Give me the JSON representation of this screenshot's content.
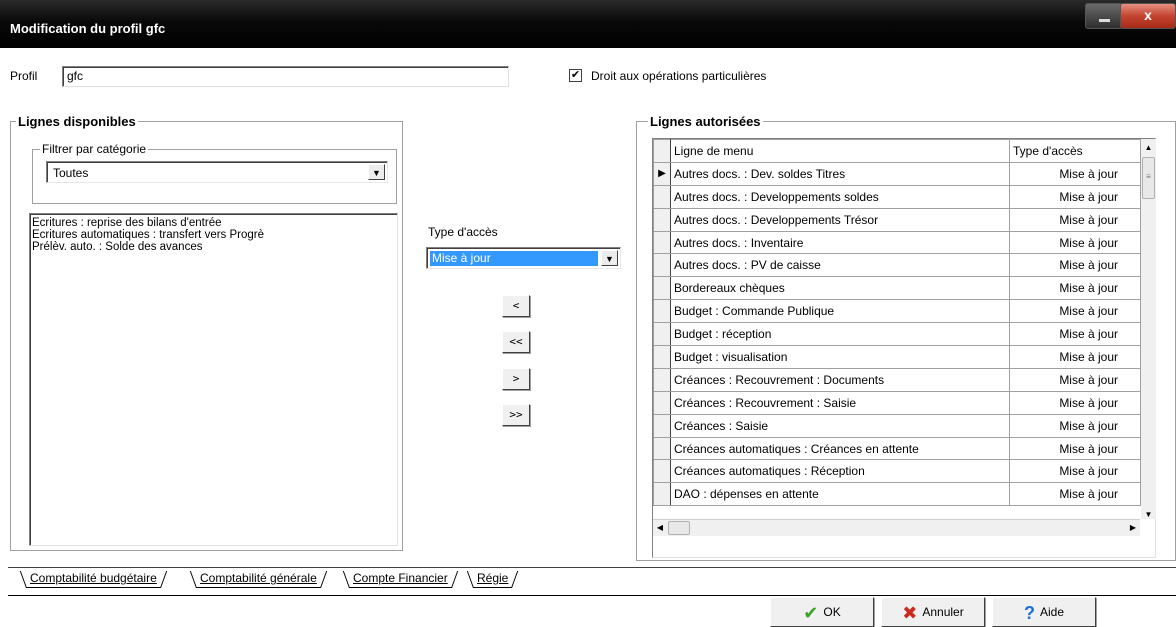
{
  "window": {
    "title": "Modification du profil gfc",
    "close_label": "x"
  },
  "profile": {
    "label": "Profil",
    "value": "gfc"
  },
  "special_ops": {
    "checked": true,
    "check_mark": "✔",
    "label": "Droit aux opérations particulières"
  },
  "available": {
    "title": "Lignes disponibles",
    "filter_title": "Filtrer par catégorie",
    "filter_value": "Toutes",
    "items": [
      "Ecritures : reprise des bilans d'entrée",
      "Ecritures automatiques : transfert vers Progrè",
      "Prélèv. auto. : Solde des avances"
    ]
  },
  "access": {
    "label": "Type d'accès",
    "value": "Mise à jour"
  },
  "move_buttons": {
    "left_one": "<",
    "left_all": "<<",
    "right_one": ">",
    "right_all": ">>"
  },
  "authorized": {
    "title": "Lignes autorisées",
    "col_menu": "Ligne de menu",
    "col_access": "Type d'accès",
    "current_marker": "▶",
    "rows": [
      {
        "menu": "Autres docs. : Dev. soldes Titres",
        "access": "Mise à jour"
      },
      {
        "menu": "Autres docs. : Developpements soldes",
        "access": "Mise à jour"
      },
      {
        "menu": "Autres docs. : Developpements Trésor",
        "access": "Mise à jour"
      },
      {
        "menu": "Autres docs. : Inventaire",
        "access": "Mise à jour"
      },
      {
        "menu": "Autres docs. : PV de caisse",
        "access": "Mise à jour"
      },
      {
        "menu": "Bordereaux chèques",
        "access": "Mise à jour"
      },
      {
        "menu": "Budget : Commande Publique",
        "access": "Mise à jour"
      },
      {
        "menu": "Budget : réception",
        "access": "Mise à jour"
      },
      {
        "menu": "Budget : visualisation",
        "access": "Mise à jour"
      },
      {
        "menu": "Créances : Recouvrement : Documents",
        "access": "Mise à jour"
      },
      {
        "menu": "Créances : Recouvrement : Saisie",
        "access": "Mise à jour"
      },
      {
        "menu": "Créances : Saisie",
        "access": "Mise à jour"
      },
      {
        "menu": "Créances automatiques : Créances en attente",
        "access": "Mise à jour"
      },
      {
        "menu": "Créances automatiques : Réception",
        "access": "Mise à jour"
      },
      {
        "menu": "DAO : dépenses en attente",
        "access": "Mise à jour"
      }
    ]
  },
  "tabs": [
    "Comptabilité budgétaire",
    "Comptabilité générale",
    "Compte Financier",
    "Régie"
  ],
  "buttons": {
    "ok": "OK",
    "cancel": "Annuler",
    "help": "Aide"
  },
  "icons": {
    "ok": "check-icon",
    "cancel": "cross-icon",
    "help": "question-icon"
  },
  "colors": {
    "selection": "#3399ff",
    "ok_icon": "#3da326",
    "cancel_icon": "#cc2a1e",
    "help_icon": "#1a6fd8"
  }
}
